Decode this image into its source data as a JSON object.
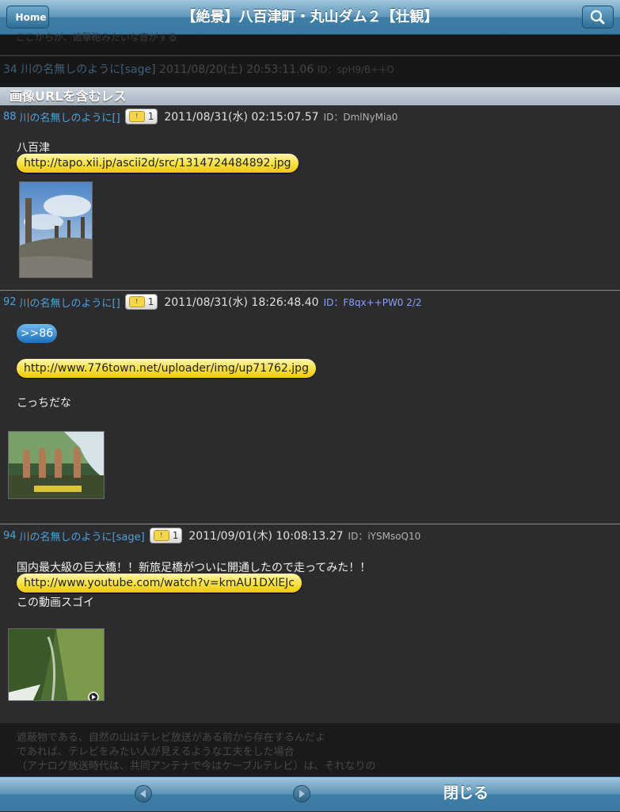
{
  "nav": {
    "home_label": "Home",
    "title": "【絶景】八百津町・丸山ダム２【壮観】"
  },
  "dim_top": {
    "faded_text": "ここからが、追撃砲みたいな音がする",
    "post": {
      "num": "34",
      "name": "川の名無しのように[sage]",
      "date": "2011/08/20(土) 20:53:11.06",
      "id": "ID：spH9/B++O"
    }
  },
  "section_title": "画像URLを含むレス",
  "posts": [
    {
      "num": "88",
      "name": "川の名無しのように[]",
      "reply_count": "1",
      "date": "2011/08/31(水) 02:15:07.57",
      "id": "ID：DmlNyMia0",
      "text": "八百津",
      "url": "http://tapo.xii.jp/ascii2d/src/1314724484892.jpg"
    },
    {
      "num": "92",
      "name": "川の名無しのように[]",
      "reply_count": "1",
      "date": "2011/08/31(水) 18:26:48.40",
      "id": "ID：F8qx++PW0 2/2",
      "anchor": ">>86",
      "url": "http://www.776town.net/uploader/img/up71762.jpg",
      "text": "こっちだな"
    },
    {
      "num": "94",
      "name": "川の名無しのように[sage]",
      "reply_count": "1",
      "date": "2011/09/01(木) 10:08:13.27",
      "id": "ID：iYSMsoQ10",
      "text": "国内最大級の巨大橋！！新旅足橋がついに開通したので走ってみた！！",
      "url": "http://www.youtube.com/watch?v=kmAU1DXlEJc",
      "text2": "この動画スゴイ"
    }
  ],
  "dim_bottom": {
    "lines": [
      "遮蔽物である、自然の山はテレビ放送がある前から存在するんだよ",
      "であれば、テレビをみたい人が見えるような工夫をした場合",
      "（アナログ放送時代は、共同アンテナで今はケーブルテレビ）は、それなりの"
    ]
  },
  "toolbar": {
    "close_label": "閉じる"
  }
}
